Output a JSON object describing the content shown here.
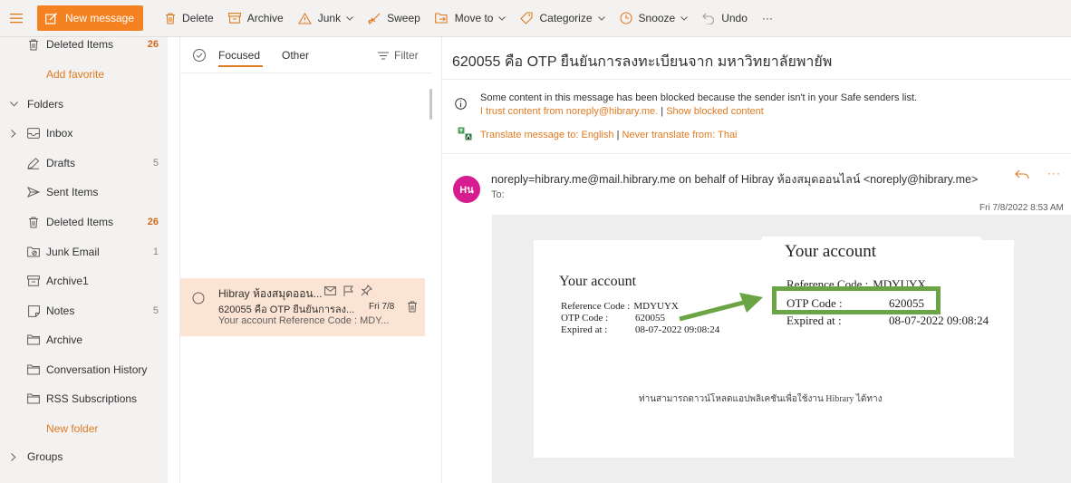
{
  "colors": {
    "accent": "#f58220",
    "link": "#e07a20",
    "selected_row": "#fbe4d4",
    "avatar": "#d61c8e",
    "highlight": "#6aa444"
  },
  "toolbar": {
    "new_message": "New message",
    "delete": "Delete",
    "archive": "Archive",
    "junk": "Junk",
    "sweep": "Sweep",
    "move_to": "Move to",
    "categorize": "Categorize",
    "snooze": "Snooze",
    "undo": "Undo",
    "more": "···"
  },
  "nav": {
    "favorites_deleted": {
      "label": "Deleted Items",
      "count": "26"
    },
    "add_favorite": "Add favorite",
    "folders_label": "Folders",
    "folders": [
      {
        "label": "Inbox",
        "count": "",
        "icon": "inbox-icon"
      },
      {
        "label": "Drafts",
        "count": "5",
        "icon": "drafts-icon"
      },
      {
        "label": "Sent Items",
        "count": "",
        "icon": "sent-icon"
      },
      {
        "label": "Deleted Items",
        "count": "26",
        "icon": "trash-icon"
      },
      {
        "label": "Junk Email",
        "count": "1",
        "icon": "junk-icon"
      },
      {
        "label": "Archive1",
        "count": "",
        "icon": "archive-icon"
      },
      {
        "label": "Notes",
        "count": "5",
        "icon": "notes-icon"
      },
      {
        "label": "Archive",
        "count": "",
        "icon": "folder-icon"
      },
      {
        "label": "Conversation History",
        "count": "",
        "icon": "folder-icon"
      },
      {
        "label": "RSS Subscriptions",
        "count": "",
        "icon": "folder-icon"
      }
    ],
    "new_folder": "New folder",
    "groups_label": "Groups"
  },
  "list": {
    "tab_focused": "Focused",
    "tab_other": "Other",
    "filter": "Filter",
    "item": {
      "sender": "Hibray ห้องสมุดออน...",
      "subject": "620055 คือ OTP ยืนยันการลง...",
      "date": "Fri 7/8",
      "preview": "Your account Reference Code : MDY..."
    }
  },
  "reading": {
    "subject": "620055 คือ OTP ยืนยันการลงทะเบียนจาก มหาวิทยาลัยพายัพ",
    "blocked_text": "Some content in this message has been blocked because the sender isn't in your Safe senders list.",
    "trust_link": "I trust content from noreply@hibrary.me.",
    "show_blocked_link": "Show blocked content",
    "translate_link": "Translate message to: English",
    "never_translate_link": "Never translate from: Thai",
    "avatar_initials": "Hน",
    "from": "noreply=hibrary.me@mail.hibrary.me on behalf of Hibray ห้องสมุดออนไลน์ <noreply@hibrary.me>",
    "to_label": "To:",
    "date": "Fri 7/8/2022 8:53 AM",
    "more": "···"
  },
  "email_body": {
    "title": "Your account",
    "ref_label": "Reference Code :",
    "ref_value": "MDYUYX",
    "otp_label": "OTP Code :",
    "otp_value": "620055",
    "exp_label": "Expired at :",
    "exp_value": "08-07-2022 09:08:24",
    "footer": "ท่านสามารถดาวน์โหลดแอปพลิเคชันเพื่อใช้งาน Hibrary ได้ทาง"
  },
  "zoom": {
    "title": "Your account",
    "ref_label": "Reference Code :",
    "ref_value": "MDYUYX",
    "otp_label": "OTP Code :",
    "otp_value": "620055",
    "exp_label": "Expired at :",
    "exp_value": "08-07-2022 09:08:24"
  }
}
